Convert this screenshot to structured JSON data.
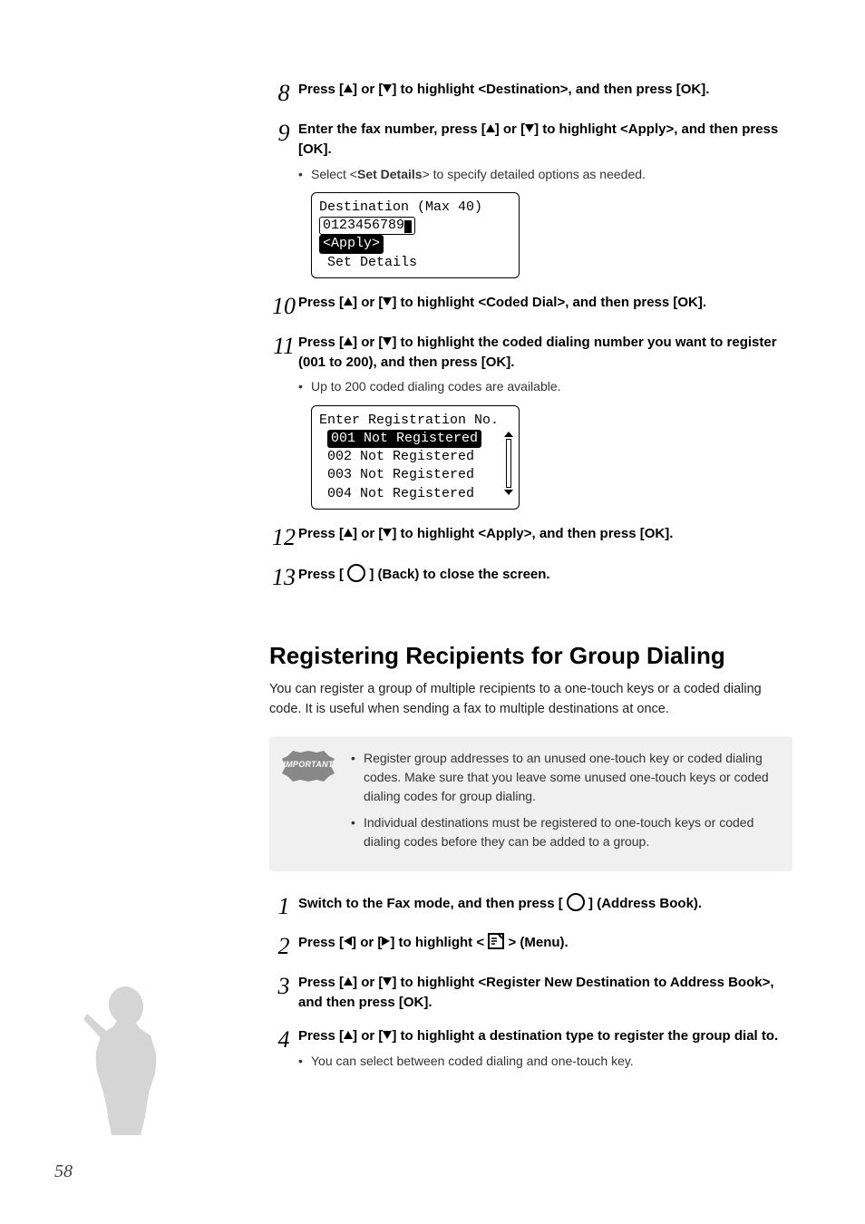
{
  "steps_a": [
    {
      "num": "8",
      "title_parts": [
        "Press [",
        "UP",
        "] or [",
        "DOWN",
        "] to highlight <Destination>, and then press [OK]."
      ]
    },
    {
      "num": "9",
      "title_parts": [
        "Enter the fax number, press [",
        "UP",
        "] or [",
        "DOWN",
        "] to highlight <Apply>, and then press [OK]."
      ],
      "bullets": [
        "Select <Set Details> to specify detailed options as needed."
      ],
      "lcd": {
        "type": "dest",
        "header": "Destination (Max 40)",
        "value": "0123456789",
        "selected": "<Apply>",
        "extra": " Set Details"
      }
    },
    {
      "num": "10",
      "title_parts": [
        "Press [",
        "UP",
        "] or [",
        "DOWN",
        "] to highlight <Coded Dial>, and then press [OK]."
      ]
    },
    {
      "num": "11",
      "title_parts": [
        "Press [",
        "UP",
        "] or [",
        "DOWN",
        "] to highlight the coded dialing number you want to register (001 to 200), and then press [OK]."
      ],
      "bullets": [
        "Up to 200 coded dialing codes are available."
      ],
      "lcd": {
        "type": "reg",
        "header": "Enter Registration No.",
        "rows": [
          "001 Not Registered",
          "002 Not Registered",
          "003 Not Registered",
          "004 Not Registered"
        ],
        "selected_index": 0
      }
    },
    {
      "num": "12",
      "title_parts": [
        "Press [",
        "UP",
        "] or [",
        "DOWN",
        "] to highlight <Apply>, and then press [OK]."
      ]
    },
    {
      "num": "13",
      "title_parts": [
        "Press [ ",
        "CIRCLE",
        " ] (Back) to close the screen."
      ]
    }
  ],
  "section_heading": "Registering Recipients for Group Dialing",
  "section_para": "You can register a group of multiple recipients to a one-touch keys or a coded dialing code. It is useful when sending a fax to multiple destinations at once.",
  "important_label": "IMPORTANT",
  "important_items": [
    "Register group addresses to an unused one-touch key or coded dialing codes. Make sure that you leave some unused one-touch keys or coded dialing codes for group dialing.",
    "Individual destinations must be registered to one-touch keys or coded dialing codes before they can be added to a group."
  ],
  "steps_b": [
    {
      "num": "1",
      "title_parts": [
        "Switch to the Fax mode, and then press [ ",
        "CIRCLE",
        " ] (Address Book)."
      ]
    },
    {
      "num": "2",
      "title_parts": [
        "Press [",
        "LEFT",
        "] or [",
        "RIGHT",
        "] to highlight < ",
        "MENU",
        " > (Menu)."
      ]
    },
    {
      "num": "3",
      "title_parts": [
        "Press [",
        "UP",
        "] or [",
        "DOWN",
        "] to highlight <Register New Destination to Address Book>, and then press [OK]."
      ]
    },
    {
      "num": "4",
      "title_parts": [
        "Press [",
        "UP",
        "] or [",
        "DOWN",
        "] to highlight a destination type to register the group dial to."
      ],
      "bullets": [
        "You can select between coded dialing and one-touch key."
      ]
    }
  ],
  "set_details_strong": "Set Details",
  "page_number": "58"
}
